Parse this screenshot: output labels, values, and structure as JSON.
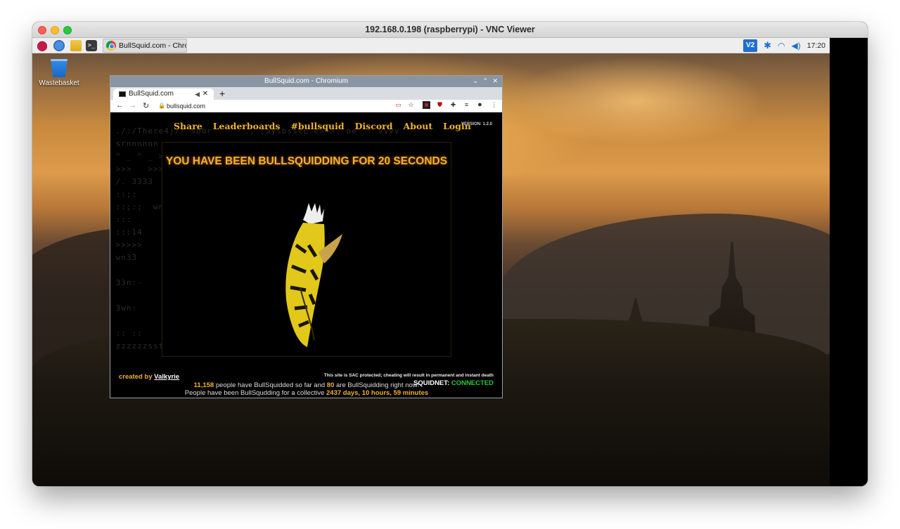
{
  "vnc": {
    "title": "192.168.0.198 (raspberrypi) - VNC Viewer"
  },
  "taskbar": {
    "terminal_glyph": ">_",
    "task_label": "BullSquid.com - Chro...",
    "tray": {
      "vnc_label": "V2",
      "time": "17:20"
    }
  },
  "desktop": {
    "wastebasket_label": "Wastebasket"
  },
  "browser": {
    "window_title": "BullSquid.com - Chromium",
    "tab_title": "BullSquid.com",
    "url": "bullsquid.com"
  },
  "site": {
    "nav": [
      "Share",
      "Leaderboards",
      "#bullsquid",
      "Discord",
      "About",
      "Login"
    ],
    "version": "VERSION: 1.2.0",
    "headline": "YOU HAVE BEEN BULLSQUIDDING FOR 20 SECONDS",
    "stats": {
      "total_people": "11,158",
      "line1_mid": " people have BullSquidded so far and ",
      "active_now": "80",
      "line1_end": " are BullSquidding right now!",
      "line2_start": "People have been BullSqudding for a collective ",
      "collective_time": "2437 days, 10 hours, 59 minutes"
    },
    "credits_prefix": "created by ",
    "credits_author": "Valkyrie",
    "sac_notice": "This site is SAC protected; cheating will result in permanent and instant death",
    "squidnet_label": "SQUIDNET: ",
    "squidnet_status": "CONNECTED"
  },
  "colors": {
    "accent": "#f0b32c",
    "connected": "#25c93a"
  }
}
